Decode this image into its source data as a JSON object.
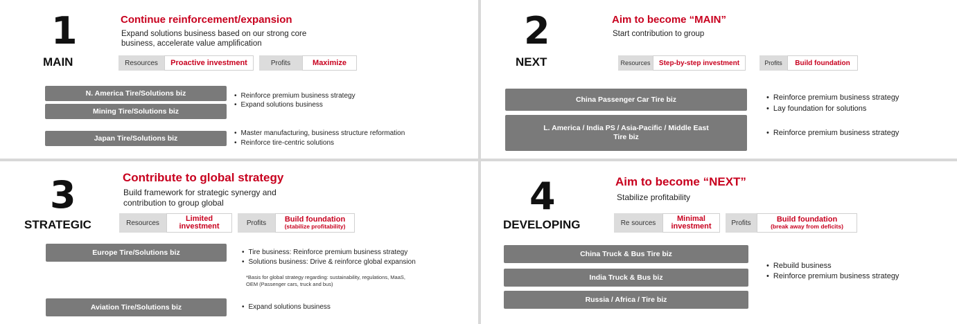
{
  "panels": {
    "main": {
      "number": "1",
      "category": "MAIN",
      "title": "Continue reinforcement/expansion",
      "subtitle_line1": "Expand solutions business based on our strong core",
      "subtitle_line2": "business, accelerate value amplification",
      "resources_label": "Resources",
      "resources_value": "Proactive investment",
      "profits_label": "Profits",
      "profits_value": "Maximize",
      "biz": [
        "N. America Tire/Solutions biz",
        "Mining Tire/Solutions biz",
        "Japan Tire/Solutions biz"
      ],
      "bullets": [
        "Reinforce premium business strategy",
        "Expand solutions business",
        "Master manufacturing, business structure reformation",
        "Reinforce tire-centric solutions"
      ]
    },
    "next": {
      "number": "2",
      "category": "NEXT",
      "title": "Aim to become “MAIN”",
      "subtitle": "Start contribution to group",
      "resources_label": "Resources",
      "resources_value": "Step-by-step investment",
      "profits_label": "Profits",
      "profits_value": "Build foundation",
      "biz": [
        "China Passenger Car Tire biz",
        "L. America / India PS / Asia-Pacific / Middle East",
        "Tire biz"
      ],
      "bullets": [
        "Reinforce premium business strategy",
        "Lay foundation for solutions",
        "Reinforce premium business strategy"
      ]
    },
    "strategic": {
      "number": "3",
      "category": "STRATEGIC",
      "title": "Contribute to global strategy",
      "subtitle_line1": "Build framework for strategic synergy and",
      "subtitle_line2": "contribution to group global",
      "resources_label": "Resources",
      "resources_value_line1": "Limited",
      "resources_value_line2": "investment",
      "profits_label": "Profits",
      "profits_value": "Build foundation",
      "profits_note": "(stabilize profitability)",
      "biz": [
        "Europe Tire/Solutions biz",
        "Aviation Tire/Solutions biz"
      ],
      "bullets": [
        "Tire business: Reinforce premium business strategy",
        "Solutions business: Drive & reinforce global expansion",
        "Expand solutions business"
      ],
      "note_line1": "*Basis for global strategy regarding: sustainability, regulations, MaaS,",
      "note_line2": "OEM (Passenger cars, truck and bus)"
    },
    "developing": {
      "number": "4",
      "category": "DEVELOPING",
      "title": "Aim to become “NEXT”",
      "subtitle": "Stabilize profitability",
      "resources_label": "Re sources",
      "resources_value_line1": "Minimal",
      "resources_value_line2": "investment",
      "profits_label": "Profits",
      "profits_value": "Build foundation",
      "profits_note": "(break away from deficits)",
      "biz": [
        "China Truck & Bus Tire biz",
        "India Truck & Bus biz",
        "Russia / Africa / Tire biz"
      ],
      "bullets": [
        "Rebuild business",
        "Reinforce premium business strategy"
      ]
    }
  },
  "colors": {
    "accent": "#c8001e",
    "biz_box": "#7a7a7a",
    "label_box": "#dcdcdc",
    "background": "#d8d8d8"
  }
}
